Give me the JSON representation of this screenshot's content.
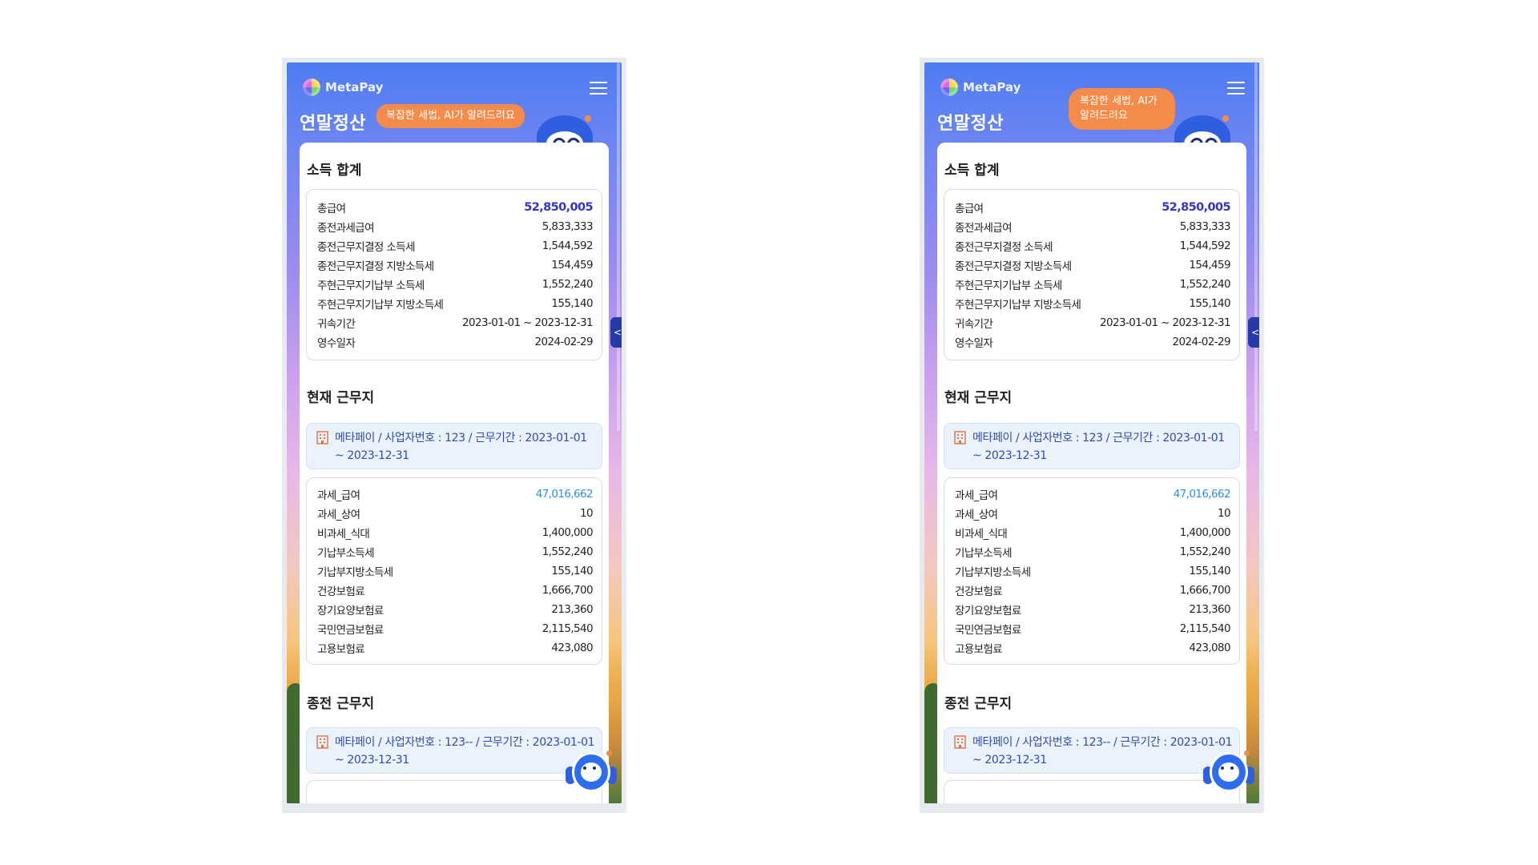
{
  "app": {
    "logo_text": "MetaPay",
    "page_title": "연말정산",
    "bubble_text": "복잡한 세법, AI가 알려드려요",
    "side_tab_label": "<",
    "colors": {
      "accent": "#3236c4",
      "bubble": "#f48b4a",
      "work_text": "#3249b8",
      "blue_value": "#2e8df0"
    }
  },
  "income_summary": {
    "title": "소득 합계",
    "rows": [
      {
        "label": "총급여",
        "value": "52,850,005"
      },
      {
        "label": "종전과세급여",
        "value": "5,833,333"
      },
      {
        "label": "종전근무지결정 소득세",
        "value": "1,544,592"
      },
      {
        "label": "종전근무지결정 지방소득세",
        "value": "154,459"
      },
      {
        "label": "주현근무지기납부 소득세",
        "value": "1,552,240"
      },
      {
        "label": "주현근무지기납부 지방소득세",
        "value": "155,140"
      },
      {
        "label": "귀속기간",
        "value": "2023-01-01 ~ 2023-12-31"
      },
      {
        "label": "영수일자",
        "value": "2024-02-29"
      }
    ]
  },
  "current_work": {
    "title": "현재 근무지",
    "info": "메타페이 / 사업자번호 : 123 / 근무기간 : 2023-01-01 ~ 2023-12-31",
    "rows": [
      {
        "label": "과세_급여",
        "value": "47,016,662"
      },
      {
        "label": "과세_상여",
        "value": "10"
      },
      {
        "label": "비과세_식대",
        "value": "1,400,000"
      },
      {
        "label": "기납부소득세",
        "value": "1,552,240"
      },
      {
        "label": "기납부지방소득세",
        "value": "155,140"
      },
      {
        "label": "건강보험료",
        "value": "1,666,700"
      },
      {
        "label": "장기요양보험료",
        "value": "213,360"
      },
      {
        "label": "국민연금보험료",
        "value": "2,115,540"
      },
      {
        "label": "고용보험료",
        "value": "423,080"
      }
    ]
  },
  "previous_work": {
    "title": "종전 근무지",
    "info": "메타페이 / 사업자번호 : 123-- / 근무기간 : 2023-01-01 ~ 2023-12-31"
  }
}
